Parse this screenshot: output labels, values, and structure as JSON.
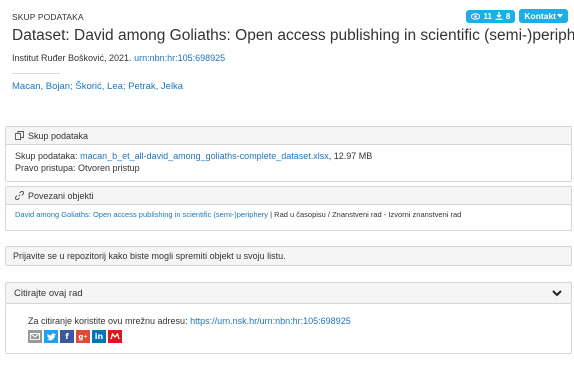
{
  "header": {
    "type_label": "SKUP PODATAKA",
    "views_icon": "eye-icon",
    "views_count": "11",
    "downloads_icon": "download-icon",
    "downloads_count": "8",
    "contact_label": "Kontakt"
  },
  "record": {
    "title": "Dataset: David among Goliaths: Open access publishing in scientific (semi-)periphery",
    "institution_year": "Institut Ruđer Bošković, 2021.",
    "urn": "urn:nbn:hr:105:698925",
    "authors": "Macan, Bojan; Škorić, Lea; Petrak, Jelka"
  },
  "dataset_panel": {
    "heading": "Skup podataka",
    "file_label": "Skup podataka:",
    "file_name": "macan_b_et_all-david_among_goliaths-complete_dataset.xlsx",
    "file_size": ", 12.97 MB",
    "access_label": "Pravo pristupa:",
    "access_value": "Otvoren pristup"
  },
  "related_panel": {
    "heading": "Povezani objekti",
    "item_title": "David among Goliaths: Open access publishing in scientific (semi-)periphery",
    "item_type": " | Rad u časopisu / Znanstveni rad - Izvorni znanstveni rad"
  },
  "login_notice": "Prijavite se u repozitorij kako biste mogli spremiti objekt u svoju listu.",
  "cite": {
    "label": "Citirajte ovaj rad",
    "permalink_label": "Za citiranje koristite ovu mrežnu adresu:",
    "permalink_url": "https://urn.nsk.hr/urn:nbn:hr:105:698925"
  },
  "share_icons": [
    "mail-icon",
    "twitter-icon",
    "facebook-icon",
    "google-plus-icon",
    "linkedin-icon",
    "mendeley-icon"
  ],
  "colors": {
    "accent": "#1eaee6",
    "link": "#1f75b8",
    "panel_bg": "#f5f5f5"
  }
}
